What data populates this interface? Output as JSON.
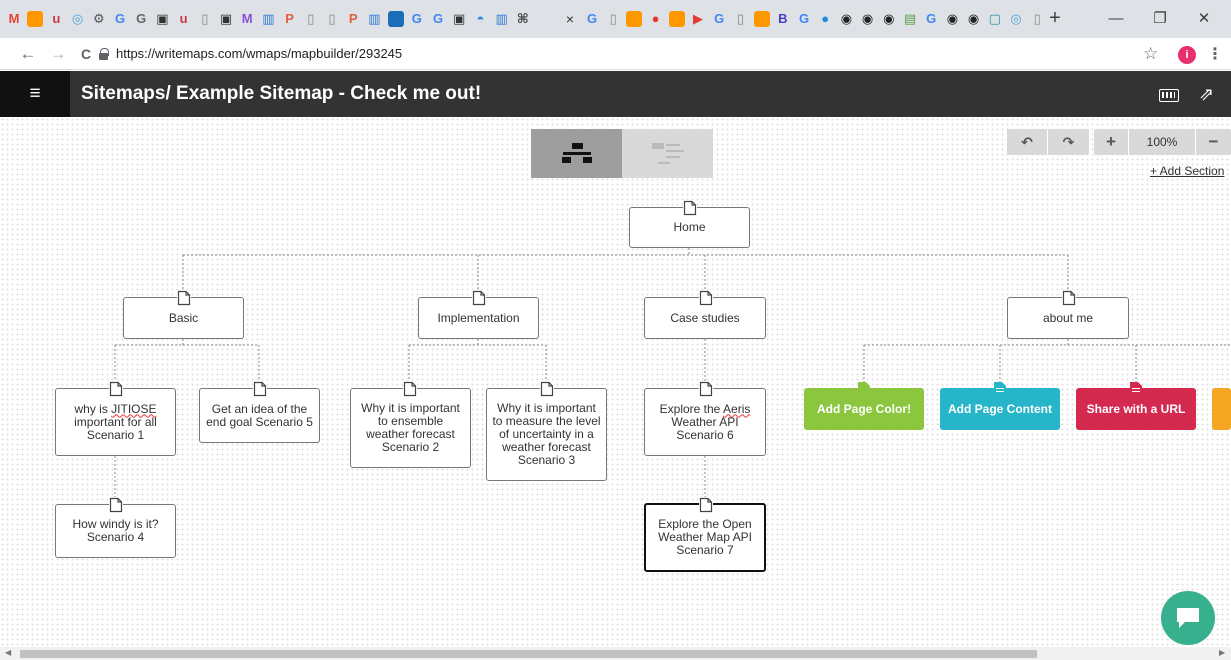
{
  "browser": {
    "url": "https://writemaps.com/wmaps/mapbuilder/293245",
    "new_tab": "+",
    "close_tab": "×",
    "win_minimize": "—",
    "win_restore": "❐",
    "win_close": "✕",
    "back": "←",
    "forward": "→",
    "reload": "C",
    "profile_initial": "i",
    "favicons": [
      {
        "name": "gmail-favicon",
        "color": "#ea4335",
        "glyph": "M"
      },
      {
        "name": "orange-favicon",
        "color": "#ff9800",
        "glyph": ""
      },
      {
        "name": "u-favicon",
        "color": "#d2354b",
        "glyph": "u"
      },
      {
        "name": "circle-favicon",
        "color": "#4fa3e0",
        "glyph": "◎"
      },
      {
        "name": "gear-favicon",
        "color": "#555",
        "glyph": "⚙"
      },
      {
        "name": "google-favicon",
        "color": "#4285f4",
        "glyph": "G"
      },
      {
        "name": "g-doc-favicon",
        "color": "#666",
        "glyph": "G"
      },
      {
        "name": "book-favicon",
        "color": "#333",
        "glyph": "▣"
      },
      {
        "name": "u2-favicon",
        "color": "#d2354b",
        "glyph": "u"
      },
      {
        "name": "page-favicon",
        "color": "#888",
        "glyph": "▯"
      },
      {
        "name": "book2-favicon",
        "color": "#333",
        "glyph": "▣"
      },
      {
        "name": "m-favicon",
        "color": "#8a4fd8",
        "glyph": "M"
      },
      {
        "name": "bars-favicon",
        "color": "#2a7bd6",
        "glyph": "▥"
      },
      {
        "name": "p-favicon",
        "color": "#e65f3d",
        "glyph": "P"
      },
      {
        "name": "page2-favicon",
        "color": "#888",
        "glyph": "▯"
      },
      {
        "name": "page3-favicon",
        "color": "#888",
        "glyph": "▯"
      },
      {
        "name": "p2-favicon",
        "color": "#e65f3d",
        "glyph": "P"
      },
      {
        "name": "bars2-favicon",
        "color": "#2a7bd6",
        "glyph": "▥"
      },
      {
        "name": "square-favicon",
        "color": "#1b6fb8",
        "glyph": ""
      },
      {
        "name": "google2-favicon",
        "color": "#4285f4",
        "glyph": "G"
      },
      {
        "name": "google3-favicon",
        "color": "#4285f4",
        "glyph": "G"
      },
      {
        "name": "book3-favicon",
        "color": "#333",
        "glyph": "▣"
      },
      {
        "name": "drop-favicon",
        "color": "#1e88e5",
        "glyph": "◓"
      },
      {
        "name": "bars3-favicon",
        "color": "#2a7bd6",
        "glyph": "▥"
      },
      {
        "name": "sitemap-favicon",
        "color": "#444",
        "glyph": "⌘"
      }
    ],
    "favicons_right": [
      {
        "name": "google4-favicon",
        "color": "#4285f4",
        "glyph": "G"
      },
      {
        "name": "page4-favicon",
        "color": "#888",
        "glyph": "▯"
      },
      {
        "name": "orange2-favicon",
        "color": "#ff9800",
        "glyph": ""
      },
      {
        "name": "red-circle-favicon",
        "color": "#e53935",
        "glyph": "●"
      },
      {
        "name": "orange3-favicon",
        "color": "#ff9800",
        "glyph": ""
      },
      {
        "name": "youtube-favicon",
        "color": "#e53935",
        "glyph": "▶"
      },
      {
        "name": "google5-favicon",
        "color": "#4285f4",
        "glyph": "G"
      },
      {
        "name": "page5-favicon",
        "color": "#888",
        "glyph": "▯"
      },
      {
        "name": "orange4-favicon",
        "color": "#ff9800",
        "glyph": ""
      },
      {
        "name": "b-favicon",
        "color": "#4a3fbf",
        "glyph": "B"
      },
      {
        "name": "google6-favicon",
        "color": "#4285f4",
        "glyph": "G"
      },
      {
        "name": "blue-circle-favicon",
        "color": "#1e88e5",
        "glyph": "●"
      },
      {
        "name": "github-favicon",
        "color": "#222",
        "glyph": "◉"
      },
      {
        "name": "github2-favicon",
        "color": "#222",
        "glyph": "◉"
      },
      {
        "name": "github3-favicon",
        "color": "#222",
        "glyph": "◉"
      },
      {
        "name": "green-favicon",
        "color": "#5aa04a",
        "glyph": "▤"
      },
      {
        "name": "google7-favicon",
        "color": "#4285f4",
        "glyph": "G"
      },
      {
        "name": "github4-favicon",
        "color": "#222",
        "glyph": "◉"
      },
      {
        "name": "github5-favicon",
        "color": "#222",
        "glyph": "◉"
      },
      {
        "name": "teal-favicon",
        "color": "#2196a6",
        "glyph": "▢"
      },
      {
        "name": "circle2-favicon",
        "color": "#4fa3e0",
        "glyph": "◎"
      },
      {
        "name": "page6-favicon",
        "color": "#888",
        "glyph": "▯"
      }
    ]
  },
  "app": {
    "menu_icon": "≡",
    "title": "Sitemaps/ Example Sitemap - Check me out!",
    "share_icon": "⇗"
  },
  "toolbar": {
    "undo": "↶",
    "redo": "↷",
    "zoom_in": "+",
    "zoom_level": "100%",
    "zoom_out": "−",
    "add_section": "+ Add Section"
  },
  "nodes": {
    "home": "Home",
    "basic": "Basic",
    "implementation": "Implementation",
    "case_studies": "Case studies",
    "about_me": "about me",
    "s1_pre": "why is ",
    "s1_word": "JITIOSE",
    "s1_post": " important for all Scenario 1",
    "s5": "Get an idea of the end goal Scenario 5",
    "s4": "How windy is it? Scenario 4",
    "s2": "Why it is important to ensemble weather forecast Scenario 2",
    "s3": "Why it is important to measure the level of uncertainty in a weather forecast Scenario 3",
    "s6_pre": "Explore the ",
    "s6_word": "Aeris",
    "s6_post": " Weather API Scenario 6",
    "s7": "Explore the Open Weather Map API Scenario 7"
  },
  "actions": {
    "color": {
      "label": "Add Page Color!",
      "bg": "#8cc63f"
    },
    "content": {
      "label": "Add Page Content",
      "bg": "#26b5c9"
    },
    "share": {
      "label": "Share with a URL",
      "bg": "#d42a50"
    },
    "more": {
      "label": "",
      "bg": "#f5a623"
    }
  },
  "colors": {
    "header_bg": "#333333",
    "chat_bg": "#36b08d"
  }
}
